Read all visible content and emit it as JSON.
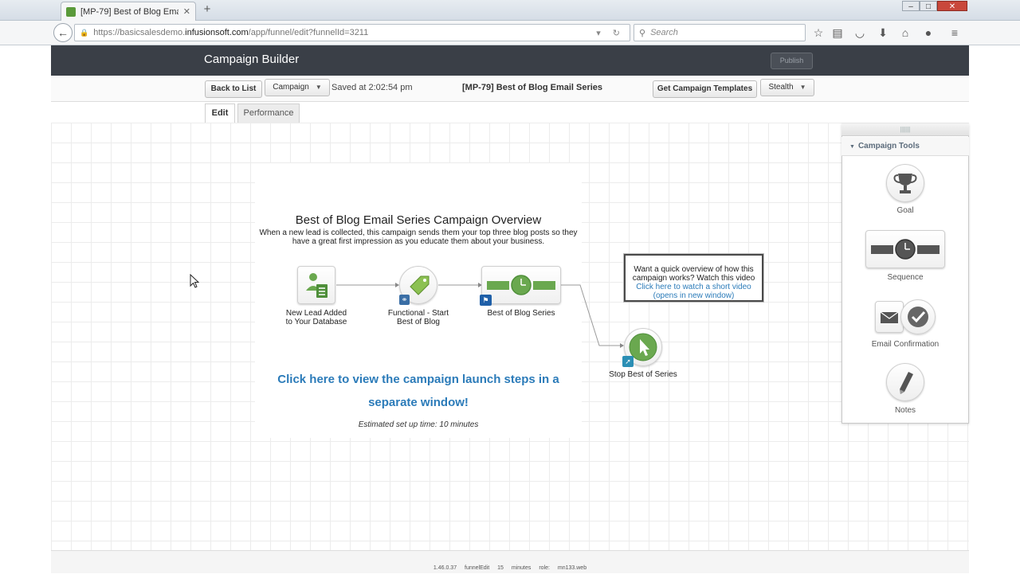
{
  "browser": {
    "tab_title": "[MP-79] Best of Blog Email...",
    "url_prefix": "https://basicsalesdemo.",
    "url_host": "infusionsoft.com",
    "url_path": "/app/funnel/edit?funnelId=3211",
    "search_placeholder": "Search"
  },
  "app": {
    "title": "Campaign Builder",
    "publish_label": "Publish"
  },
  "toolbar": {
    "back_label": "Back to List",
    "campaign_label": "Campaign",
    "saved_at": "Saved at 2:02:54 pm",
    "campaign_title": "[MP-79] Best of Blog Email Series",
    "templates_label": "Get Campaign Templates",
    "stealth_label": "Stealth"
  },
  "tabs": {
    "edit": "Edit",
    "performance": "Performance"
  },
  "overview": {
    "title": "Best of Blog Email Series Campaign Overview",
    "description": "When a new lead is collected, this campaign sends them your top three blog posts so they have a great first impression as you educate them about your business.",
    "launch_link_line1": "Click here to view the campaign launch steps in a",
    "launch_link_line2": "separate window!",
    "estimate": "Estimated set up time: 10 minutes"
  },
  "nodes": {
    "lead_line1": "New Lead Added",
    "lead_line2": "to Your Database",
    "functional_line1": "Functional - Start",
    "functional_line2": "Best of Blog",
    "series": "Best of Blog Series",
    "stop": "Stop Best of Series"
  },
  "video_box": {
    "question": "Want a quick overview of how this campaign works? Watch this video",
    "link": "Click here to watch a short video (opens in new window)"
  },
  "tools": {
    "header": "Campaign Tools",
    "goal": "Goal",
    "sequence": "Sequence",
    "email_confirmation": "Email Confirmation",
    "notes": "Notes"
  },
  "footer": {
    "version": "1.46.0.37",
    "page": "funnelEdit",
    "duration": "15 minutes",
    "role": "role: mn133.web"
  },
  "colors": {
    "app_bar": "#3a3f47",
    "link_blue": "#2b7bb9",
    "node_green": "#6aa84f"
  }
}
